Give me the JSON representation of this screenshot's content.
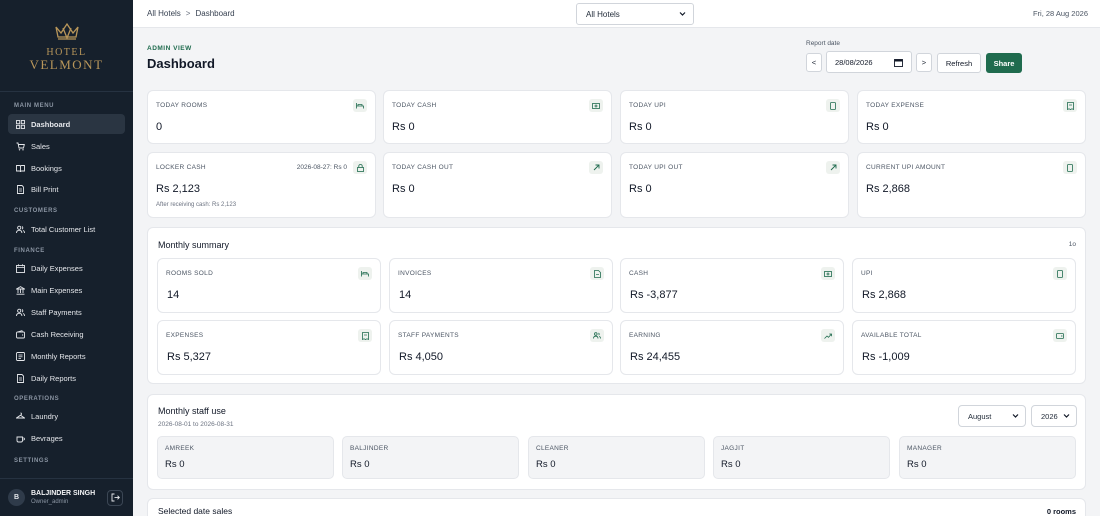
{
  "brand": {
    "line1": "HOTEL",
    "line2": "VELMONT",
    "color": "#b8965a"
  },
  "sidebar": {
    "main_menu": "MAIN MENU",
    "customers": "CUSTOMERS",
    "finance": "FINANCE",
    "operations": "OPERATIONS",
    "settings": "SETTINGS",
    "items": [
      {
        "label": "Dashboard",
        "icon": "grid-icon"
      },
      {
        "label": "Sales",
        "icon": "cart-icon"
      },
      {
        "label": "Bookings",
        "icon": "book-icon"
      },
      {
        "label": "Bill Print",
        "icon": "document-icon"
      },
      {
        "label": "Total Customer List",
        "icon": "users-icon"
      },
      {
        "label": "Daily Expenses",
        "icon": "calendar-icon"
      },
      {
        "label": "Main Expenses",
        "icon": "bank-icon"
      },
      {
        "label": "Staff Payments",
        "icon": "users-icon"
      },
      {
        "label": "Cash Receiving",
        "icon": "wallet-icon"
      },
      {
        "label": "Monthly Reports",
        "icon": "report-icon"
      },
      {
        "label": "Daily Reports",
        "icon": "document-icon"
      },
      {
        "label": "Laundry",
        "icon": "laundry-icon"
      },
      {
        "label": "Bevrages",
        "icon": "cup-icon"
      }
    ],
    "user": {
      "initial": "B",
      "name": "BALJINDER SINGH",
      "role": "Owner_admin"
    }
  },
  "topbar": {
    "crumb_root": "All Hotels",
    "crumb_sep": ">",
    "crumb_current": "Dashboard",
    "hotel_select": "All Hotels",
    "date": "Fri, 28 Aug 2026"
  },
  "header": {
    "eyebrow": "ADMIN VIEW",
    "title": "Dashboard",
    "report_date_label": "Report date",
    "report_date": "28/08/2026",
    "prev": "<",
    "next": ">",
    "refresh": "Refresh",
    "share": "Share"
  },
  "today_cards": [
    {
      "label": "TODAY ROOMS",
      "value": "0",
      "icon": "bed-icon"
    },
    {
      "label": "TODAY CASH",
      "value": "Rs 0",
      "icon": "cash-icon"
    },
    {
      "label": "TODAY UPI",
      "value": "Rs 0",
      "icon": "phone-icon"
    },
    {
      "label": "TODAY EXPENSE",
      "value": "Rs 0",
      "icon": "receipt-icon"
    },
    {
      "label": "LOCKER CASH",
      "value": "Rs 2,123",
      "icon": "lock-icon",
      "side": "2026-08-27: Rs 0",
      "sub": "After receiving cash: Rs 2,123"
    },
    {
      "label": "TODAY CASH OUT",
      "value": "Rs 0",
      "icon": "arrow-out-icon"
    },
    {
      "label": "TODAY UPI OUT",
      "value": "Rs 0",
      "icon": "arrow-out-icon"
    },
    {
      "label": "CURRENT UPI AMOUNT",
      "value": "Rs 2,868",
      "icon": "phone-icon"
    }
  ],
  "monthly": {
    "title": "Monthly summary",
    "badge": "1o",
    "cards": [
      {
        "label": "ROOMS SOLD",
        "value": "14",
        "icon": "bed-icon"
      },
      {
        "label": "INVOICES",
        "value": "14",
        "icon": "invoice-icon"
      },
      {
        "label": "CASH",
        "value": "Rs -3,877",
        "icon": "cash-icon"
      },
      {
        "label": "UPI",
        "value": "Rs 2,868",
        "icon": "phone-icon"
      },
      {
        "label": "EXPENSES",
        "value": "Rs 5,327",
        "icon": "receipt-icon"
      },
      {
        "label": "STAFF PAYMENTS",
        "value": "Rs 4,050",
        "icon": "users-icon"
      },
      {
        "label": "EARNING",
        "value": "Rs 24,455",
        "icon": "trend-up-icon"
      },
      {
        "label": "AVAILABLE TOTAL",
        "value": "Rs -1,009",
        "icon": "wallet-icon"
      }
    ]
  },
  "staff_use": {
    "title": "Monthly staff use",
    "range": "2026-08-01 to 2026-08-31",
    "month": "August",
    "year": "2026",
    "staff": [
      {
        "name": "AMREEK",
        "value": "Rs 0"
      },
      {
        "name": "BALJINDER",
        "value": "Rs 0"
      },
      {
        "name": "CLEANER",
        "value": "Rs 0"
      },
      {
        "name": "JAGJIT",
        "value": "Rs 0"
      },
      {
        "name": "MANAGER",
        "value": "Rs 0"
      }
    ]
  },
  "selected_sales": {
    "title": "Selected date sales",
    "rooms": "0 rooms"
  },
  "colors": {
    "accent": "#1f6b4e",
    "sidebar": "#16202c",
    "gold": "#b8965a"
  }
}
